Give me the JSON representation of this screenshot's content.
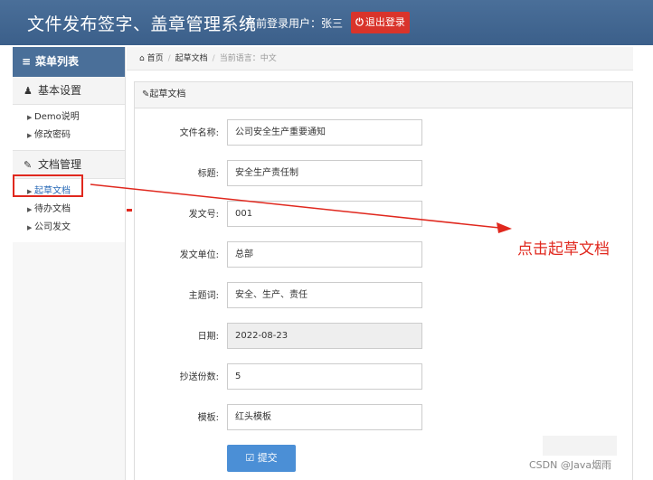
{
  "header": {
    "title": "文件发布签字、盖章管理系统",
    "user_info": "当前登录用户：张三",
    "logout_label": "退出登录"
  },
  "sidebar": {
    "heading": "菜单列表",
    "groups": [
      {
        "label": "基本设置",
        "items": [
          {
            "label": "Demo说明"
          },
          {
            "label": "修改密码"
          }
        ]
      },
      {
        "label": "文档管理",
        "items": [
          {
            "label": "起草文档"
          },
          {
            "label": "待办文档"
          },
          {
            "label": "公司发文"
          }
        ]
      }
    ]
  },
  "breadcrumb": {
    "home": "首页",
    "section": "起草文档",
    "language": "当前语言：中文"
  },
  "panel": {
    "title": "起草文档"
  },
  "form": {
    "fields": [
      {
        "label": "文件名称:",
        "value": "公司安全生产重要通知"
      },
      {
        "label": "标题:",
        "value": "安全生产责任制"
      },
      {
        "label": "发文号:",
        "value": "001"
      },
      {
        "label": "发文单位:",
        "value": "总部"
      },
      {
        "label": "主题词:",
        "value": "安全、生产、责任"
      },
      {
        "label": "日期:",
        "value": "2022-08-23"
      },
      {
        "label": "抄送份数:",
        "value": "5"
      },
      {
        "label": "模板:",
        "value": "红头模板"
      }
    ],
    "submit_label": "提交"
  },
  "annotation": "点击起草文档",
  "credit": "CSDN @Java烟雨",
  "colors": {
    "header": "#3b5f8a",
    "accent": "#4b8fd6",
    "danger": "#d9342b",
    "annotation": "#e0281e"
  }
}
